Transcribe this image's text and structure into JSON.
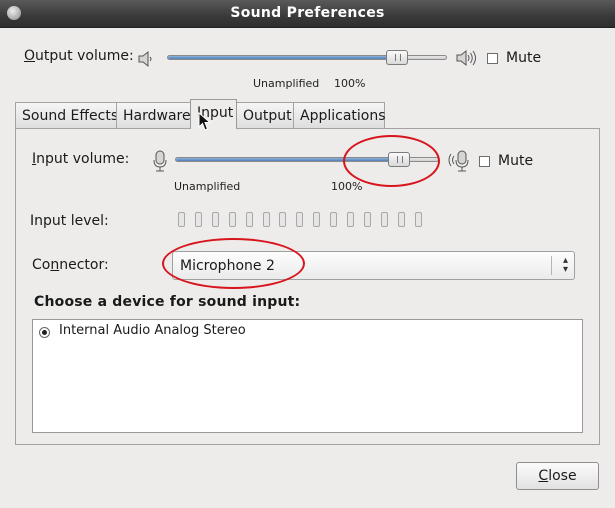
{
  "window": {
    "title": "Sound Preferences"
  },
  "output_volume": {
    "label_mnemonic": "O",
    "label_rest": "utput volume:",
    "tick_low": "Unamplified",
    "tick_high": "100%",
    "level_fraction": 0.82,
    "mute_label": "Mute",
    "muted": false
  },
  "tabs": [
    {
      "label": "Sound Effects"
    },
    {
      "label": "Hardware"
    },
    {
      "label": "Input",
      "active": true
    },
    {
      "label": "Output"
    },
    {
      "label": "Applications"
    }
  ],
  "input": {
    "volume_label_mnemonic": "I",
    "volume_label_rest": "nput volume:",
    "tick_low": "Unamplified",
    "tick_high": "100%",
    "level_fraction": 0.85,
    "mute_label": "Mute",
    "muted": false,
    "level_label": "Input level:",
    "connector_label_pre": "Co",
    "connector_label_mnemonic": "n",
    "connector_label_post": "nector:",
    "connector_value": "Microphone 2",
    "device_heading": "Choose a device for sound input:",
    "devices": [
      {
        "name": "Internal Audio Analog Stereo",
        "selected": true
      }
    ]
  },
  "close_button": {
    "mnemonic": "C",
    "rest": "lose"
  },
  "colors": {
    "annotation": "#d8141c",
    "slider_fill": "#4f7fb8"
  }
}
